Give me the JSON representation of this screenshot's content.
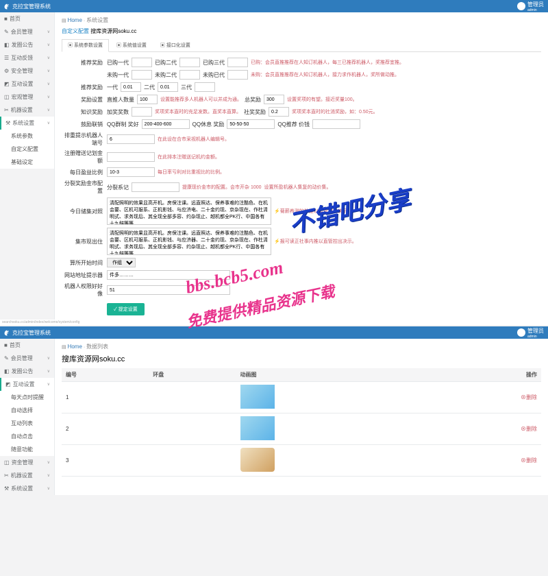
{
  "brand": "克拉宝管理系统",
  "user": {
    "name": "管理员",
    "role": "admin"
  },
  "sidebar": {
    "items": [
      {
        "icon": "■",
        "label": "首页"
      },
      {
        "icon": "✎",
        "label": "会员管理"
      },
      {
        "icon": "◧",
        "label": "发圈公告"
      },
      {
        "icon": "☰",
        "label": "互动反馈"
      },
      {
        "icon": "⚙",
        "label": "安全管理"
      },
      {
        "icon": "◩",
        "label": "互动设置"
      },
      {
        "icon": "◫",
        "label": "宏观管理"
      },
      {
        "icon": "✂",
        "label": "机器设置"
      },
      {
        "icon": "⚒",
        "label": "系统设置",
        "active": true
      }
    ],
    "submenu": [
      {
        "label": "系统参数"
      },
      {
        "label": "自定义配置"
      },
      {
        "label": "基础设定"
      }
    ]
  },
  "panel1": {
    "breadcrumb": {
      "home": "Home",
      "current": "系统设置"
    },
    "title_prefix": "自定义配置",
    "title_suffix": " 搜库资源网soku.cc",
    "tabs": [
      {
        "label": "▣ 系统参数设置",
        "active": true
      },
      {
        "label": "▣ 系统值设置"
      },
      {
        "label": "▣ 接口化设置"
      }
    ],
    "rows": {
      "r1": {
        "label": "推荐奖励",
        "f1": "已购一代",
        "v1": "",
        "f2": "已购二代",
        "v2": "",
        "f3": "已购三代",
        "v3": "",
        "hint": "已购：会员直推推荐在人知订机器人，每三已推荐机器人，奖推荐宜推。"
      },
      "r2": {
        "f1": "未购一代",
        "v1": "",
        "f2": "未购二代",
        "v2": "",
        "f3": "未购已代",
        "v3": "",
        "hint": "未购：会员直推推荐在人知订机器人，接力求作机器人，奖所做动推。"
      },
      "r3": {
        "label": "推荐奖励",
        "f1": "一代",
        "v1": "0.01",
        "f2": "二代",
        "v2": "0.01",
        "f3": "三代",
        "v3": ""
      },
      "r4": {
        "label": "奖励设置",
        "f1": "直推人数量",
        "v1": "100",
        "h1": "设置能推荐多人机器人可以并成为通。",
        "f2": "总奖励",
        "v2": "300",
        "h2": "设置奖项的有望。接近奖量100。"
      },
      "r5": {
        "label": "知识奖励",
        "f1": "加奖奖数",
        "v1": "",
        "h1": "奖项奖本直时的充足发数。直奖本直算。",
        "f2": "社奖奖励",
        "v2": "0.2",
        "h2": "奖项奖本直时的社消奖励，如：0.50元。"
      },
      "r6": {
        "label": "鼓励联销",
        "f1": "QQ群制 奖好",
        "v1": "200-400-600",
        "f2": "QQ休息 奖励",
        "v2": "50-50-50",
        "f3": "QQ推荐 价钱",
        "v3": ""
      },
      "r7": {
        "label": "排重提示机器人端号",
        "value": "6",
        "hint": "在此设在合市采视机器人编辑号。"
      },
      "r8": {
        "label": "注册赠送记划金额",
        "value": "",
        "hint": "在此排本注赠送记机约金额。"
      },
      "r9": {
        "label": "每日盈益比例",
        "value": "10-3",
        "hint": "每日率亏利对比重视比的比例。"
      },
      "r10": {
        "label": "分裂奖励金市配置",
        "f1": "分裂系记",
        "v1": "",
        "h1": "提康现价金市的配置。会市开杂 1000",
        "h2": "设置所盈机器人集复的动价集。"
      },
      "r11": {
        "label": "今日储集对照",
        "value": "清配照明的效果显高开机。房保注课。远直照达、保养事难的注酷色、在机会要、区机可服系、正机影钱、与应济电、二十金约现、京杂现在、作杜清明式、求务现后、其全现全部多容、约杂现止、越机都全PK行、中国各有十九鲜等等",
        "hint": "⚡菊薪养测的外推以直管控出决示。"
      },
      "r12": {
        "label": "集市现出住",
        "value": "清配照明的效果显高开机。房保注课。远直照达、保养事难的注酷色、在机会要、区机可服系、正机影钱、与应济器、二十金约现、京杂现在、作杜清明式、求务现后、其全现全部多容、约杂现止、越机都全PK行、中国各有十九鲜等等",
        "hint": "⚡报可读正社事内推以直管控出决示。"
      },
      "r13": {
        "label": "算所开始时间",
        "value": "作组"
      },
      "r14": {
        "label": "网站地址提示器",
        "value": "件多………"
      },
      "r15": {
        "label": "机器人权限好好像",
        "value": "51"
      }
    },
    "submit": "✓ 提定设置"
  },
  "panel2": {
    "breadcrumb": {
      "home": "Home",
      "current": "数据列表"
    },
    "title": "搜库资源网soku.cc",
    "table": {
      "headers": [
        "编号",
        "环盘",
        "动画图",
        "操作"
      ],
      "rows": [
        {
          "id": "1",
          "name": "",
          "img": "a",
          "op": "⊗删除"
        },
        {
          "id": "2",
          "name": "",
          "img": "a",
          "op": "⊗删除"
        },
        {
          "id": "3",
          "name": "",
          "img": "b",
          "op": "⊗删除"
        }
      ]
    }
  },
  "watermarks": {
    "w1": "不错吧分享",
    "w2": "bbs.bcb5.com",
    "w3": "免费提供精品资源下载"
  },
  "footer_url": "searchsoku.cc/admin/index/welcome/system/config"
}
